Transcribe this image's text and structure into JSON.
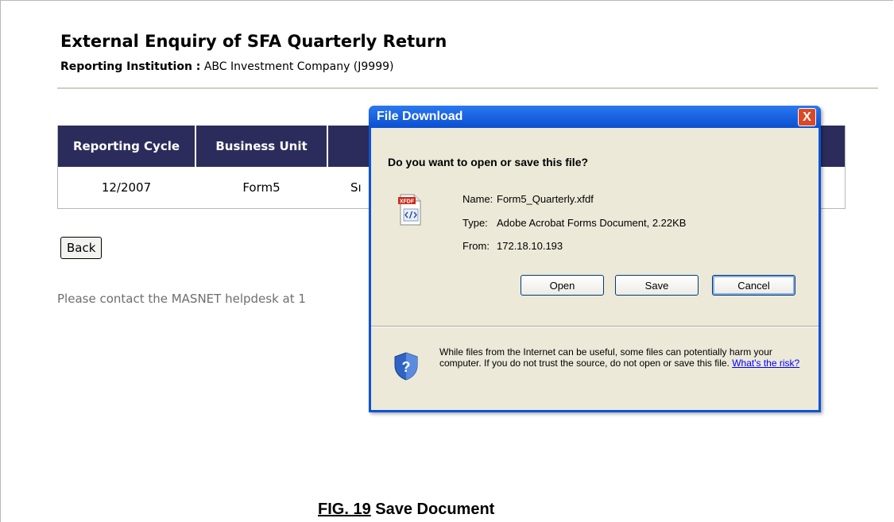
{
  "page": {
    "title": "External Enquiry of SFA Quarterly Return",
    "institution_label": "Reporting Institution :",
    "institution_value": "ABC Investment Company (J9999)"
  },
  "table": {
    "headers": [
      "Reporting Cycle",
      "Business Unit",
      ""
    ],
    "row": [
      "12/2007",
      "Form5",
      "Sı"
    ]
  },
  "back_label": "Back",
  "help_text": "Please contact the MASNET helpdesk at 1",
  "dialog": {
    "title": "File Download",
    "close_glyph": "X",
    "question": "Do you want to open or save this file?",
    "file_icon_badge": "XFDF",
    "name_label": "Name:",
    "name_value": "Form5_Quarterly.xfdf",
    "type_label": "Type:",
    "type_value": "Adobe Acrobat Forms Document, 2.22KB",
    "from_label": "From:",
    "from_value": "172.18.10.193",
    "open_label": "Open",
    "save_label": "Save",
    "cancel_label": "Cancel",
    "warning_text": "While files from the Internet can be useful, some files can potentially harm your computer. If you do not trust the source, do not open or save this file.",
    "risk_link": "What's the risk?"
  },
  "caption": {
    "fig": "FIG. 19",
    "text": "Save Document"
  }
}
